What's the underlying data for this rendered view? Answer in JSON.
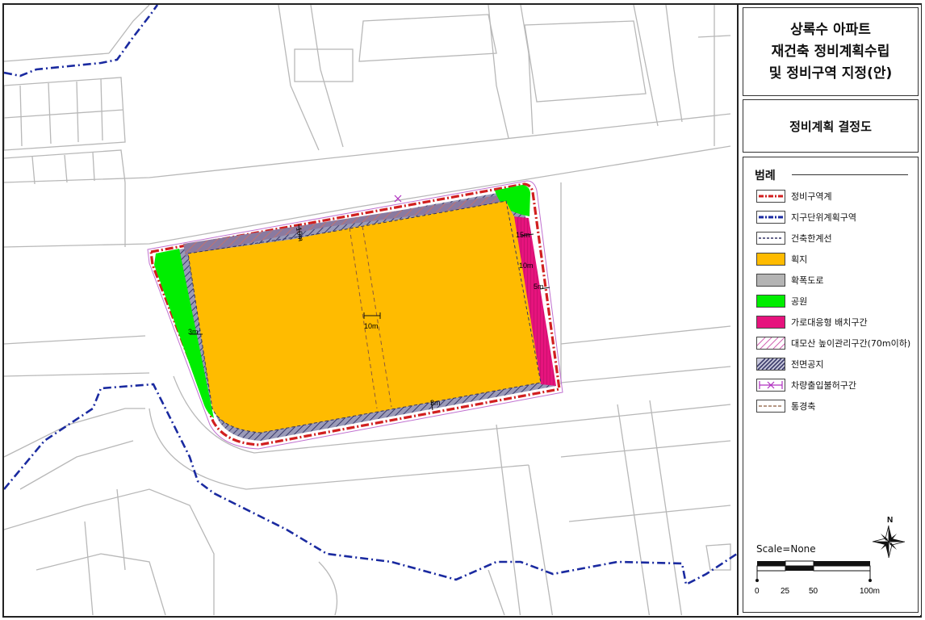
{
  "title": {
    "line1": "상록수 아파트",
    "line2": "재건축 정비계획수립",
    "line3": "및 정비구역 지정(안)"
  },
  "subtitle": "정비계획 결정도",
  "legend": {
    "title": "범례",
    "items": [
      {
        "id": "redevelopment-boundary",
        "label": "정비구역계",
        "symbol": "red-dash-dot-line",
        "color": "#d11f1f"
      },
      {
        "id": "district-unit-plan-area",
        "label": "지구단위계획구역",
        "symbol": "blue-dash-dot-line",
        "color": "#1a2aa0"
      },
      {
        "id": "building-line",
        "label": "건축한계선",
        "symbol": "dark-dashed-line",
        "color": "#333366"
      },
      {
        "id": "site",
        "label": "획지",
        "symbol": "fill",
        "color": "#ffbb00"
      },
      {
        "id": "widened-road",
        "label": "확폭도로",
        "symbol": "fill",
        "color": "#b4b4b4"
      },
      {
        "id": "park",
        "label": "공원",
        "symbol": "fill",
        "color": "#00ee00"
      },
      {
        "id": "street-facing-zone",
        "label": "가로대응형 배치구간",
        "symbol": "fill",
        "color": "#e6137d"
      },
      {
        "id": "daemosan-height-zone",
        "label": "대모산 높이관리구간(70m이하)",
        "symbol": "pink-hatch",
        "color": "#d060b0"
      },
      {
        "id": "front-open-space",
        "label": "전면공지",
        "symbol": "navy-hatch",
        "color": "#3a3a6a"
      },
      {
        "id": "no-vehicle-access",
        "label": "차량출입불허구간",
        "symbol": "purple-x-line",
        "color": "#b030c0"
      },
      {
        "id": "view-corridor",
        "label": "통경축",
        "symbol": "brown-dashed-line",
        "color": "#8b5a3a"
      }
    ]
  },
  "map": {
    "dimension_labels": [
      "10m",
      "15m",
      "10m",
      "5m",
      "3m",
      "10m",
      "3m"
    ],
    "colors": {
      "site": "#ffbb00",
      "park": "#00ee00",
      "street_facing": "#e6137d",
      "boundary": "#d11f1f",
      "district_line": "#1a2aa0",
      "parcel_lines": "#b8b8b8",
      "front_space": "#8080a0"
    }
  },
  "scale": {
    "text": "Scale=None",
    "ticks": [
      "0",
      "25",
      "50",
      "100m"
    ]
  },
  "north_arrow": {
    "label": "N"
  }
}
